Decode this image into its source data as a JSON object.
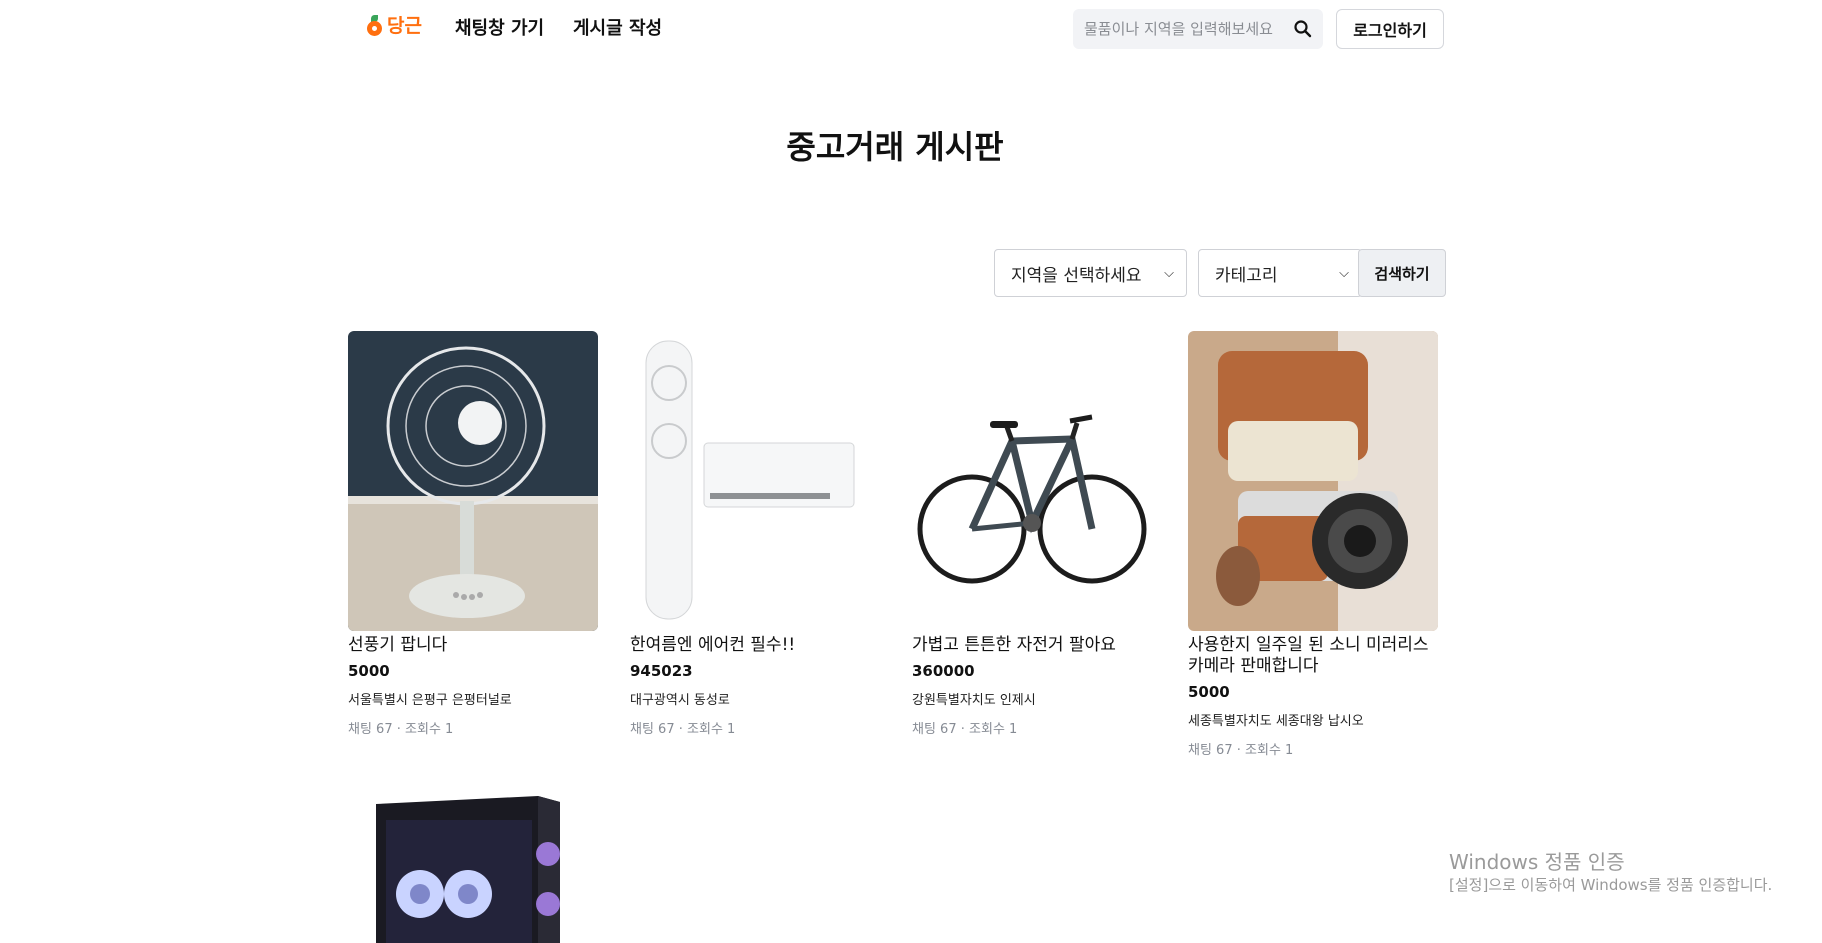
{
  "header": {
    "logo_text": "당근",
    "nav": [
      "채팅창 가기",
      "게시글 작성"
    ],
    "search_placeholder": "물품이나 지역을 입력해보세요",
    "login_label": "로그인하기"
  },
  "page": {
    "title": "중고거래 게시판"
  },
  "filters": {
    "region_selected": "지역을 선택하세요",
    "category_selected": "카테고리",
    "search_label": "검색하기"
  },
  "items": [
    {
      "title": "선풍기 팝니다",
      "price": "5000",
      "region": "서울특별시 은평구 은평터널로",
      "chat": "채팅 67",
      "dot": "·",
      "views": "조회수 1",
      "image_icon": "electric-fan"
    },
    {
      "title": "한여름엔 에어컨 필수!!",
      "price": "945023",
      "region": "대구광역시 동성로",
      "chat": "채팅 67",
      "dot": "·",
      "views": "조회수 1",
      "image_icon": "air-conditioner"
    },
    {
      "title": "가볍고 튼튼한 자전거 팔아요",
      "price": "360000",
      "region": "강원특별자치도 인제시",
      "chat": "채팅 67",
      "dot": "·",
      "views": "조회수 1",
      "image_icon": "bicycle"
    },
    {
      "title": "사용한지 일주일 된 소니 미러리스 카메라 판매합니다",
      "price": "5000",
      "region": "세종특별자치도 세종대왕 납시오",
      "chat": "채팅 67",
      "dot": "·",
      "views": "조회수 1",
      "image_icon": "camera"
    },
    {
      "image_icon": "computer-case"
    }
  ],
  "watermark": {
    "line1": "Windows 정품 인증",
    "line2": "[설정]으로 이동하여 Windows를 정품 인증합니다."
  },
  "colors": {
    "brand": "#ff6f0f",
    "muted": "#868b94"
  }
}
